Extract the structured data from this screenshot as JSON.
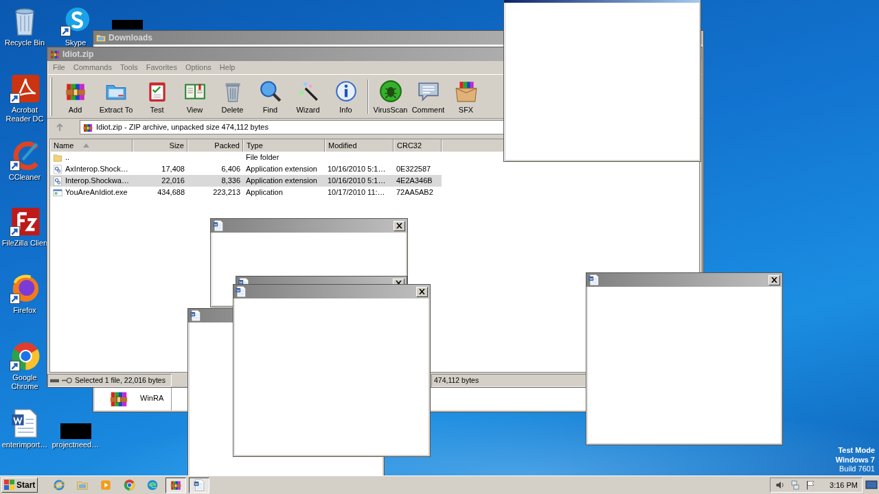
{
  "desktop_icons": [
    {
      "kind": "recycle_bin",
      "label": "Recycle Bin"
    },
    {
      "kind": "acrobat",
      "label": "Acrobat Reader DC"
    },
    {
      "kind": "ccleaner",
      "label": "CCleaner"
    },
    {
      "kind": "filezilla",
      "label": "FileZilla Clien"
    },
    {
      "kind": "firefox",
      "label": "Firefox"
    },
    {
      "kind": "chrome",
      "label": "Google Chrome"
    },
    {
      "kind": "word_doc",
      "label": "enterimport…"
    },
    {
      "kind": "skype",
      "label": "Skype"
    },
    {
      "kind": "blank",
      "label": "projectneed…"
    },
    {
      "kind": "blank"
    }
  ],
  "windows": [
    {
      "kind": "explorer",
      "title": "Downloads",
      "items": [
        {
          "label": "WinRA"
        }
      ]
    },
    {
      "kind": "winrar",
      "title": "Idiot.zip",
      "menu": [
        "File",
        "Commands",
        "Tools",
        "Favorites",
        "Options",
        "Help"
      ],
      "toolbar": [
        {
          "kind": "add",
          "label": "Add"
        },
        {
          "kind": "extract",
          "label": "Extract To"
        },
        {
          "kind": "test",
          "label": "Test"
        },
        {
          "kind": "view",
          "label": "View"
        },
        {
          "kind": "delete",
          "label": "Delete"
        },
        {
          "kind": "find",
          "label": "Find"
        },
        {
          "kind": "wizard",
          "label": "Wizard"
        },
        {
          "kind": "info",
          "label": "Info"
        },
        {
          "kind": "virusscan",
          "label": "VirusScan"
        },
        {
          "kind": "comment",
          "label": "Comment"
        },
        {
          "kind": "sfx",
          "label": "SFX"
        }
      ],
      "address": "Idiot.zip - ZIP archive, unpacked size 474,112 bytes",
      "columns": [
        {
          "label": "Name",
          "sorted": true
        },
        {
          "label": "Size",
          "sorted": false
        },
        {
          "label": "Packed",
          "sorted": false
        },
        {
          "label": "Type",
          "sorted": false
        },
        {
          "label": "Modified",
          "sorted": false
        },
        {
          "label": "CRC32",
          "sorted": false
        }
      ],
      "rows": [
        {
          "kind": "folder",
          "selected": false,
          "name": "..",
          "type": "File folder"
        },
        {
          "kind": "dll",
          "selected": false,
          "name": "AxInterop.Shock…",
          "size": "17,408",
          "packed": "6,406",
          "type": "Application extension",
          "modified": "10/16/2010 5:1…",
          "crc": "0E322587"
        },
        {
          "kind": "dll",
          "selected": true,
          "name": "Interop.Shockwa…",
          "size": "22,016",
          "packed": "8,336",
          "type": "Application extension",
          "modified": "10/16/2010 5:1…",
          "crc": "4E2A346B"
        },
        {
          "kind": "exe",
          "selected": false,
          "name": "YouAreAnIdiot.exe",
          "size": "434,688",
          "packed": "223,213",
          "type": "Application",
          "modified": "10/17/2010 11:…",
          "crc": "72AA5AB2"
        }
      ],
      "status_left": "Selected 1 file, 22,016 bytes",
      "status_right": "474,112 bytes"
    },
    {
      "kind": "popup",
      "active": true,
      "icon": false,
      "close": false
    },
    {
      "kind": "popup",
      "active": false,
      "icon": true,
      "close": true
    },
    {
      "kind": "popup",
      "active": false,
      "icon": true,
      "close": true
    },
    {
      "kind": "popup",
      "active": false,
      "icon": true,
      "close": false
    },
    {
      "kind": "popup",
      "active": false,
      "icon": true,
      "close": true
    },
    {
      "kind": "popup",
      "active": false,
      "icon": true,
      "close": true
    }
  ],
  "os_notice": [
    "Test Mode",
    "Windows 7",
    "Build 7601"
  ],
  "taskbar": {
    "start_label": "Start",
    "buttons": [
      {
        "kind": "ie",
        "selected": false
      },
      {
        "kind": "explorer",
        "selected": false
      },
      {
        "kind": "media",
        "selected": false
      },
      {
        "kind": "chrome",
        "selected": false
      },
      {
        "kind": "edge",
        "selected": false
      },
      {
        "kind": "winrar",
        "selected": true
      },
      {
        "kind": "word",
        "selected": true
      }
    ],
    "tray": [
      {
        "kind": "volume"
      },
      {
        "kind": "network"
      },
      {
        "kind": "flag"
      }
    ],
    "clock": "3:16 PM"
  }
}
